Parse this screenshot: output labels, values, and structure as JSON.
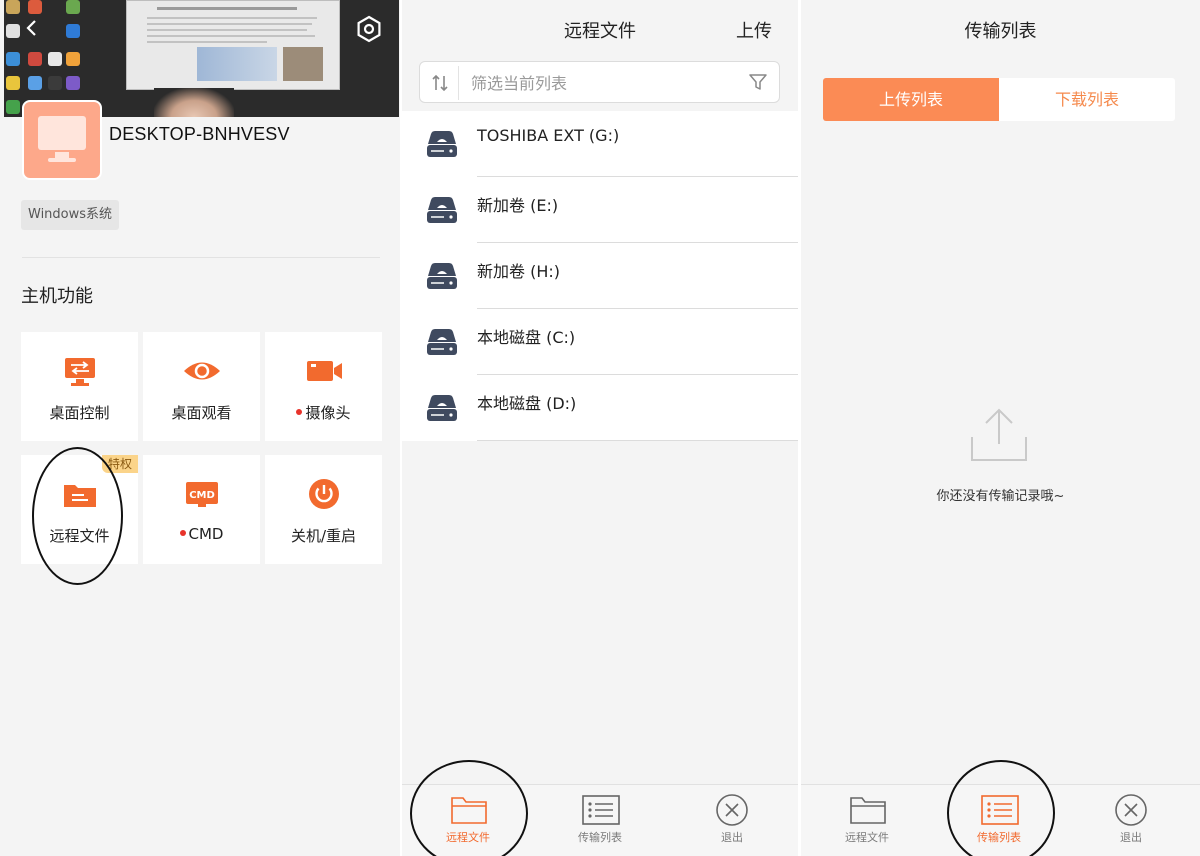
{
  "host": {
    "device_name": "DESKTOP-BNHVESV",
    "os_badge": "Windows系统",
    "section_title": "主机功能",
    "functions": [
      {
        "label": "桌面控制",
        "icon": "desktop-control-icon",
        "dot": false,
        "badge": ""
      },
      {
        "label": "桌面观看",
        "icon": "eye-icon",
        "dot": false,
        "badge": ""
      },
      {
        "label": "摄像头",
        "icon": "camera-icon",
        "dot": true,
        "badge": ""
      },
      {
        "label": "远程文件",
        "icon": "folder-icon",
        "dot": false,
        "badge": "特权"
      },
      {
        "label": "CMD",
        "icon": "cmd-icon",
        "dot": true,
        "badge": ""
      },
      {
        "label": "关机/重启",
        "icon": "power-icon",
        "dot": false,
        "badge": ""
      }
    ]
  },
  "files": {
    "title": "远程文件",
    "upload_label": "上传",
    "search_placeholder": "筛选当前列表",
    "drives": [
      {
        "name": "TOSHIBA EXT (G:)"
      },
      {
        "name": "新加卷 (E:)"
      },
      {
        "name": "新加卷 (H:)"
      },
      {
        "name": "本地磁盘 (C:)"
      },
      {
        "name": "本地磁盘 (D:)"
      }
    ]
  },
  "transfer": {
    "title": "传输列表",
    "tab_upload": "上传列表",
    "tab_download": "下载列表",
    "empty_text": "你还没有传输记录哦~"
  },
  "tabbar": {
    "files_label": "远程文件",
    "transfer_label": "传输列表",
    "exit_label": "退出"
  },
  "colors": {
    "accent": "#f26a2e",
    "segment_active": "#fb8b55",
    "drive_icon": "#3f4a5f",
    "badge": "#fbd48a"
  }
}
